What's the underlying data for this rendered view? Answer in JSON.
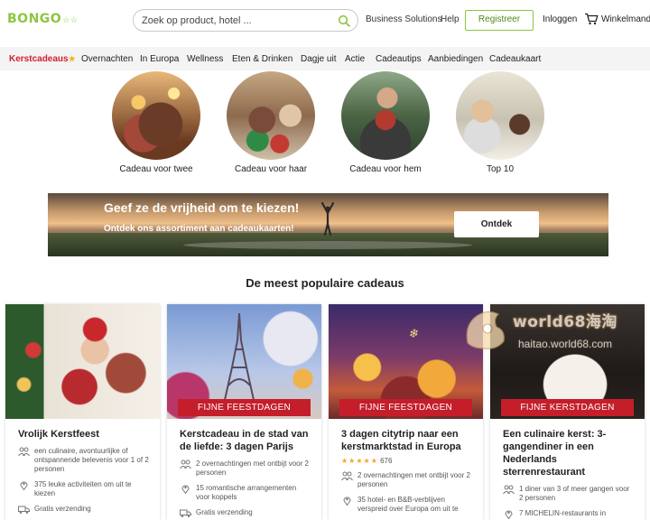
{
  "header": {
    "logo": "BONGO",
    "search_placeholder": "Zoek op product, hotel ...",
    "links": [
      "Business Solutions",
      "Help"
    ],
    "register": "Registreer",
    "login": "Inloggen",
    "cart": "Winkelmandje"
  },
  "categories": [
    "Kerstcadeaus",
    "Overnachten",
    "In Europa",
    "Wellness",
    "Eten & Drinken",
    "Dagje uit",
    "Actie",
    "Cadeautips",
    "Aanbiedingen",
    "Cadeaukaart"
  ],
  "circles": [
    "Cadeau voor twee",
    "Cadeau voor haar",
    "Cadeau voor hem",
    "Top 10"
  ],
  "banner": {
    "title": "Geef ze de vrijheid om te kiezen!",
    "subtitle": "Ontdek ons assortiment aan cadeaukaarten!",
    "button": "Ontdek"
  },
  "section_title": "De meest populaire cadeaus",
  "cards": [
    {
      "ribbon": "",
      "title": "Vrolijk Kerstfeest",
      "rating": null,
      "features": [
        "een culinaire, avontuurlijke of ontspannende belevenis voor 1 of 2 personen",
        "375 leuke activiteiten om uit te kiezen",
        "Gratis verzending"
      ]
    },
    {
      "ribbon": "FIJNE FEESTDAGEN",
      "title": "Kerstcadeau in de stad van de liefde: 3 dagen Parijs",
      "rating": null,
      "features": [
        "2 overnachtingen met ontbijt voor 2 personen",
        "15 romantische arrangementen voor koppels",
        "Gratis verzending"
      ]
    },
    {
      "ribbon": "FIJNE FEESTDAGEN",
      "title": "3 dagen citytrip naar een kerstmarktstad in Europa",
      "rating": {
        "stars": 4.5,
        "count": "676"
      },
      "features": [
        "2 overnachtingen met ontbijt voor 2 personen",
        "35 hotel- en B&B-verblijven verspreid over Europa om uit te"
      ]
    },
    {
      "ribbon": "FIJNE KERSTDAGEN",
      "title": "Een culinaire kerst: 3-gangendiner in een Nederlands sterrenrestaurant",
      "rating": null,
      "features": [
        "1 diner van 3 of meer gangen voor 2 personen",
        "7 MICHELIN-restaurants in"
      ]
    }
  ],
  "watermark": {
    "text": "world68海淘",
    "sub": "haitao.world68.com"
  },
  "colors": {
    "brand_green": "#8dc63f",
    "ribbon_red": "#c41e2a",
    "active_red": "#d4202b"
  }
}
